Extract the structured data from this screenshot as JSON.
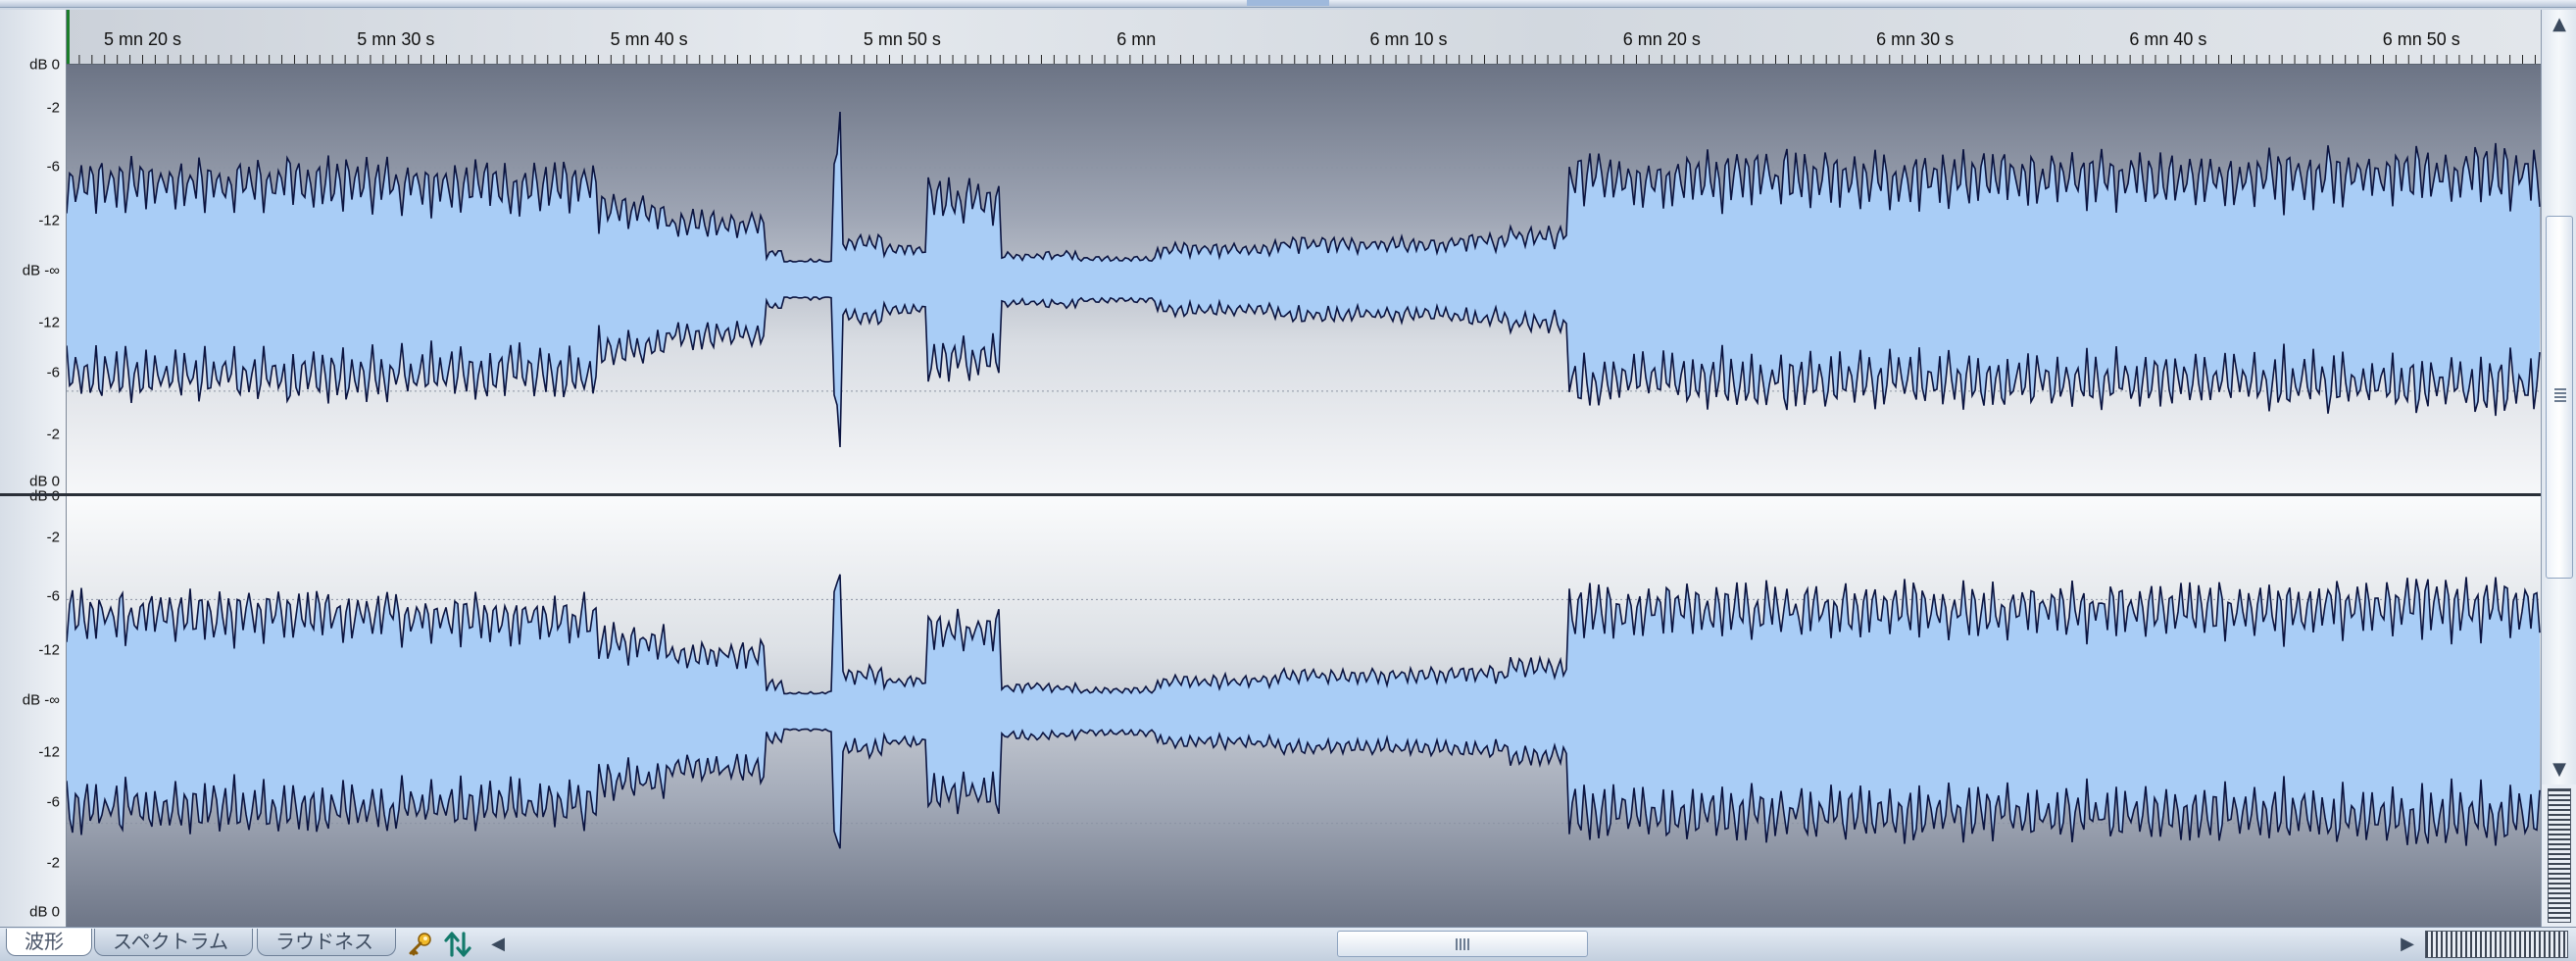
{
  "ruler": {
    "labels": [
      "5 mn 20 s",
      "5 mn 30 s",
      "5 mn 40 s",
      "5 mn 50 s",
      "6 mn",
      "6 mn 10 s",
      "6 mn 20 s",
      "6 mn 30 s",
      "6 mn 40 s",
      "6 mn 50 s"
    ]
  },
  "scale": {
    "top": [
      "dB 0",
      "-2",
      "-6",
      "-12",
      "dB -∞",
      "-12",
      "-6",
      "-2",
      "dB 0"
    ],
    "bottom": [
      "dB 0",
      "-2",
      "-6",
      "-12",
      "dB -∞",
      "-12",
      "-6",
      "-2",
      "dB 0"
    ]
  },
  "tabs": {
    "waveform": "波形",
    "spectrum": "スペクトラム",
    "loudness": "ラウドネス"
  },
  "icons": {
    "key": "key-icon",
    "sync": "sync-arrows-icon",
    "scroll_left": "◀",
    "scroll_right": "▶",
    "scroll_up": "▲",
    "scroll_down": "▼"
  },
  "colors": {
    "wave_fill": "#a9cdf6",
    "wave_stroke": "#0b1440",
    "ruler_marker": "#1b7d2a"
  }
}
